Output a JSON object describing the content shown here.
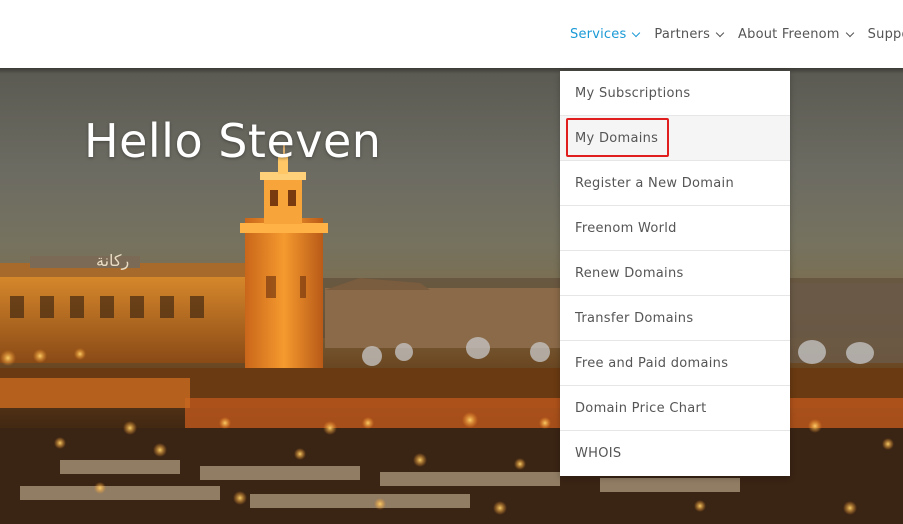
{
  "nav": {
    "items": [
      {
        "label": "Services",
        "active": true
      },
      {
        "label": "Partners",
        "active": false
      },
      {
        "label": "About Freenom",
        "active": false
      },
      {
        "label": "Support",
        "active": false
      }
    ]
  },
  "hero": {
    "greeting": "Hello Steven",
    "sign_text": "ركانة"
  },
  "dropdown": {
    "items": [
      {
        "label": "My Subscriptions"
      },
      {
        "label": "My Domains",
        "highlighted": true
      },
      {
        "label": "Register a New Domain"
      },
      {
        "label": "Freenom World"
      },
      {
        "label": "Renew Domains"
      },
      {
        "label": "Transfer Domains"
      },
      {
        "label": "Free and Paid domains"
      },
      {
        "label": "Domain Price Chart"
      },
      {
        "label": "WHOIS"
      }
    ]
  },
  "colors": {
    "accent": "#1a9ad6",
    "highlight": "#e01e1e",
    "nav_text": "#555555"
  }
}
